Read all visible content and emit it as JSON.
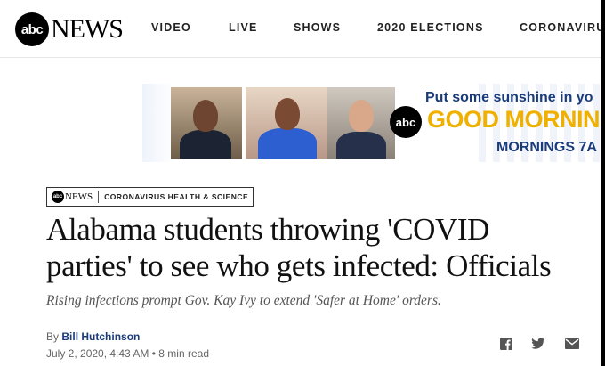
{
  "header": {
    "logo_mark": "abc",
    "logo_text": "NEWS",
    "nav": [
      "VIDEO",
      "LIVE",
      "SHOWS",
      "2020 ELECTIONS",
      "CORONAVIRU"
    ]
  },
  "banner": {
    "line1": "Put some sunshine in yo",
    "logo_mark": "abc",
    "line2": "GOOD MORNIN",
    "line3": "MORNINGS 7A",
    "accent_color": "#f0b000",
    "text_color": "#1a3c7a"
  },
  "article": {
    "badge_logo": "abc",
    "badge_news": "NEWS",
    "category": "CORONAVIRUS HEALTH & SCIENCE",
    "headline_line1": "Alabama students throwing 'COVID",
    "headline_line2": "parties' to see who gets infected: Officials",
    "subheadline": "Rising infections prompt Gov. Kay Ivy to extend 'Safer at Home' orders.",
    "byline_prefix": "By",
    "author": "Bill Hutchinson",
    "date": "July 2, 2020, 4:43 AM",
    "separator": "•",
    "read_time": "8 min read"
  },
  "share_icons": [
    "facebook-icon",
    "twitter-icon",
    "email-icon"
  ]
}
